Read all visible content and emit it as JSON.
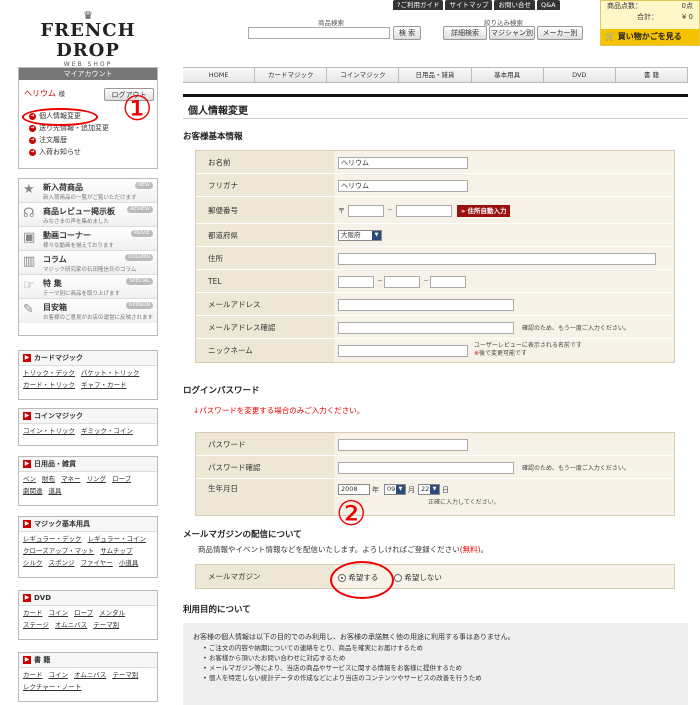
{
  "header": {
    "logo_text": "FRENCH DROP",
    "logo_sub": "WEB SHOP",
    "top_links": [
      "?ご利用ガイド",
      "サイトマップ",
      "お問い合せ",
      "Q&A"
    ],
    "search_label": "商品検索",
    "search_button": "検 索",
    "filter_label": "絞り込み検索",
    "filter_buttons": [
      "詳細検索",
      "マジシャン別",
      "メーカー別"
    ],
    "cart": {
      "items_label": "商品点数：",
      "items_value": "0点",
      "total_label": "合計：",
      "total_value": "¥ 0",
      "button": "買い物かごを見る"
    }
  },
  "nav": [
    "HOME",
    "カードマジック",
    "コインマジック",
    "日用品・雑貨",
    "基本用具",
    "DVD",
    "書 籍"
  ],
  "sidebar": {
    "account_title": "マイアカウント",
    "user_name": "ヘリウム",
    "user_suffix": "様",
    "logout": "ログアウト",
    "account_links": [
      "個人情報変更",
      "送り先情報・追加変更",
      "注文履歴",
      "入荷お知らせ"
    ],
    "features": [
      {
        "icon": "★",
        "title": "新入荷商品",
        "desc": "新入荷商品の一覧がご覧いただけます",
        "badge": "NEW"
      },
      {
        "icon": "☊",
        "title": "商品レビュー掲示板",
        "desc": "みなさまの声を集めました",
        "badge": "REVIEW"
      },
      {
        "icon": "▣",
        "title": "動画コーナー",
        "desc": "様々な動画を揃えております",
        "badge": "MOVIE"
      },
      {
        "icon": "▥",
        "title": "コラム",
        "desc": "マジック研究家の石田隆信氏のコラム",
        "badge": "COLUMN"
      },
      {
        "icon": "☞",
        "title": "特 集",
        "desc": "テーマ別に商品を取り上げます",
        "badge": "SPECIAL"
      },
      {
        "icon": "✎",
        "title": "目安箱",
        "desc": "お客様のご意見がお店の運営に反映されます",
        "badge": "OPINION"
      }
    ],
    "categories": [
      {
        "title": "カードマジック",
        "links": [
          "トリック・デック",
          "パケット・トリック",
          "カード・トリック",
          "ギャフ・カード"
        ]
      },
      {
        "title": "コインマジック",
        "links": [
          "コイン・トリック",
          "ギミック・コイン"
        ]
      },
      {
        "title": "日用品・雑貨",
        "links": [
          "ペン",
          "財布",
          "マネー",
          "リング",
          "ロープ",
          "劇関連",
          "道具"
        ]
      },
      {
        "title": "マジック基本用具",
        "links": [
          "レギュラー・デック",
          "レギュラー・コイン",
          "クローズアップ・マット",
          "サムチップ",
          "シルク",
          "スポンジ",
          "ファイヤー",
          "小道具"
        ]
      },
      {
        "title": "DVD",
        "links": [
          "カード",
          "コイン",
          "ロープ",
          "メンタル",
          "ステージ",
          "オムニバス",
          "テーマ別"
        ]
      },
      {
        "title": "書 籍",
        "links": [
          "カード",
          "コイン",
          "オムニバス",
          "テーマ別",
          "レクチャー・ノート"
        ]
      }
    ]
  },
  "main": {
    "page_title": "個人情報変更",
    "basic_section": "お客様基本情報",
    "fields": {
      "name_label": "お名前",
      "name_value": "ヘリウム",
      "furigana_label": "フリガナ",
      "furigana_value": "ヘリウム",
      "zip_label": "郵便番号",
      "zip_prefix": "〒",
      "zip_dash": "－",
      "zip_button": "» 住所自動入力",
      "pref_label": "都道府県",
      "pref_value": "大阪府",
      "address_label": "住所",
      "tel_label": "TEL",
      "tel_dash1": "－",
      "tel_dash2": "－",
      "email_label": "メールアドレス",
      "email_confirm_label": "メールアドレス確認",
      "email_confirm_note": "確認のため、もう一度ご入力ください。",
      "nickname_label": "ニックネーム",
      "nickname_note1": "ユーザーレビューに表示される名前です",
      "nickname_note2_mark": "※",
      "nickname_note2": "後で変更可能です"
    },
    "login_section": "ログインパスワード",
    "password_note": "↓パスワードを変更する場合のみご入力ください。",
    "password_label": "パスワード",
    "password_confirm_label": "パスワード確認",
    "password_confirm_note": "確認のため、もう一度ご入力ください。",
    "birth_label": "生年月日",
    "birth_year": "2008",
    "birth_year_unit": "年",
    "birth_month": "09",
    "birth_month_unit": "月",
    "birth_day": "22",
    "birth_day_unit": "日",
    "birth_note": "正確に入力してください。",
    "mail_section": "メールマガジンの配信について",
    "mail_intro": "商品情報やイベント情報などを配信いたします。よろしければご登録ください",
    "mail_free": "(無料)",
    "mail_period": "。",
    "mail_label": "メールマガジン",
    "mail_yes": "希望する",
    "mail_no": "希望しない",
    "purpose_section": "利用目的について",
    "purpose_text": "お客様の個人情報は以下の目的でのみ利用し、お客様の承諾無く他の用途に利用する事はありません。",
    "purpose_items": [
      "ご注文の内容や納期についての連絡をとり、商品を確実にお届けするため",
      "お客様から頂いたお問い合わせに対応するため",
      "メールマガジン等により、当店の商品やサービスに関する情報をお客様に提供するため",
      "個人を特定しない統計データの作成などにより当店のコンテンツやサービスの改善を行うため"
    ]
  },
  "annotations": {
    "one": "①",
    "two": "②"
  },
  "colors": {
    "accent_red": "#e00000",
    "form_label_bg": "#efe7d6",
    "form_value_bg": "#f7f2e7",
    "cart_yellow": "#f5c200"
  }
}
